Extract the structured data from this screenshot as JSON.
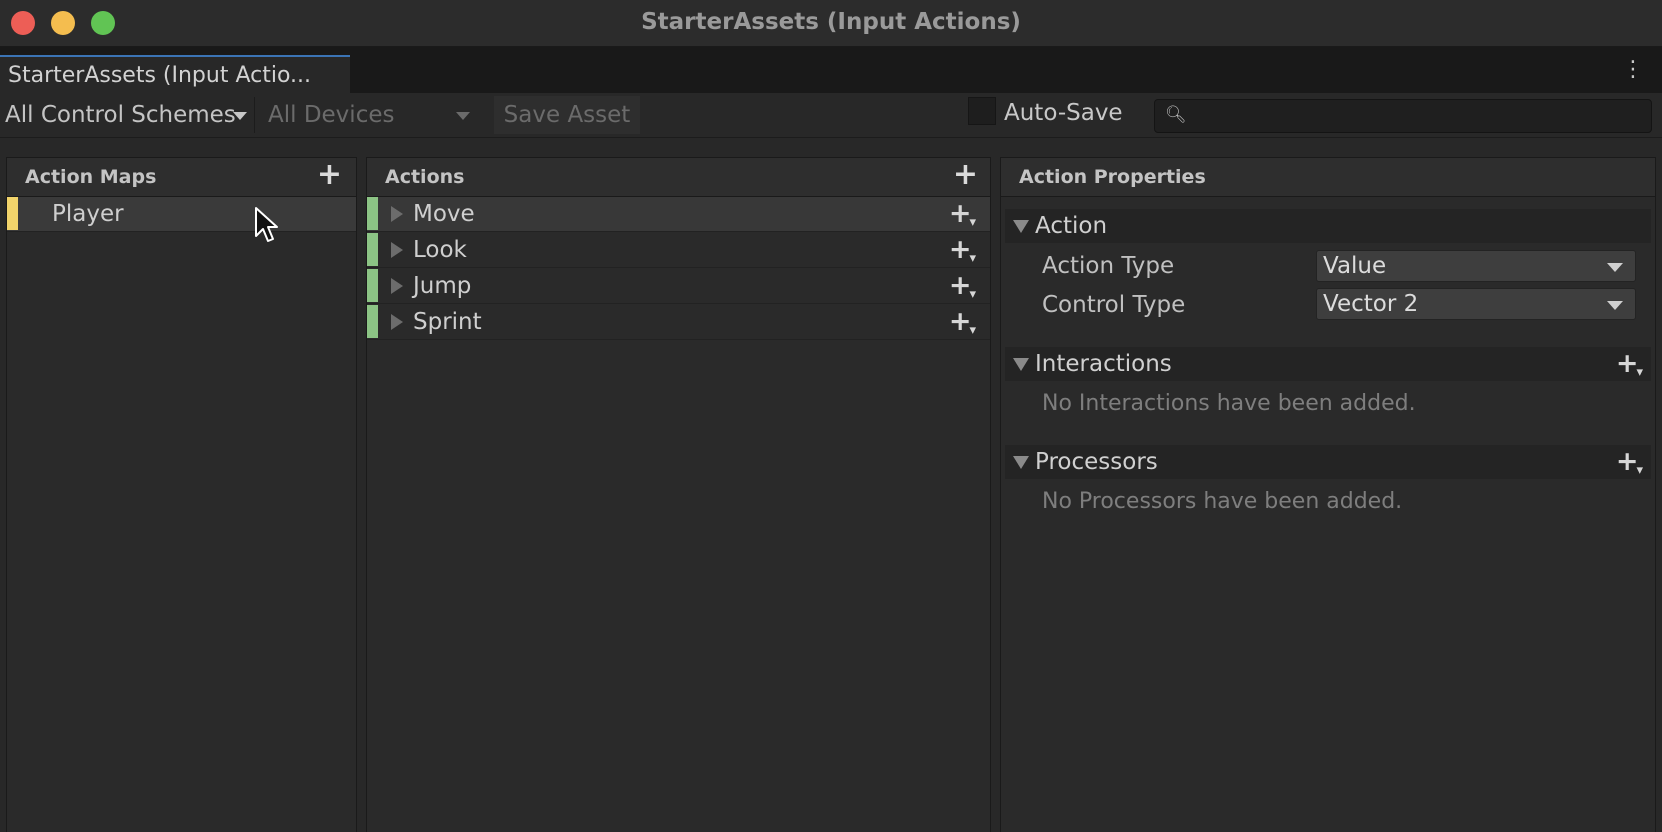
{
  "window": {
    "title": "StarterAssets (Input Actions)"
  },
  "tab": {
    "label": "StarterAssets (Input Actio...",
    "menu_icon": "kebab-menu-icon"
  },
  "toolbar": {
    "control_schemes": "All Control Schemes",
    "devices": "All Devices",
    "save_asset": "Save Asset",
    "auto_save_label": "Auto-Save",
    "auto_save_checked": false,
    "search_placeholder": ""
  },
  "action_maps": {
    "header": "Action Maps",
    "items": [
      {
        "label": "Player",
        "color": "#f2d46b"
      }
    ]
  },
  "actions": {
    "header": "Actions",
    "items": [
      {
        "label": "Move",
        "color": "#8cc485"
      },
      {
        "label": "Look",
        "color": "#8cc485"
      },
      {
        "label": "Jump",
        "color": "#8cc485"
      },
      {
        "label": "Sprint",
        "color": "#8cc485"
      }
    ]
  },
  "properties": {
    "header": "Action Properties",
    "action_section": {
      "title": "Action",
      "action_type_label": "Action Type",
      "action_type_value": "Value",
      "control_type_label": "Control Type",
      "control_type_value": "Vector 2"
    },
    "interactions": {
      "title": "Interactions",
      "empty": "No Interactions have been added."
    },
    "processors": {
      "title": "Processors",
      "empty": "No Processors have been added."
    }
  },
  "colors": {
    "map_accent": "#f2d46b",
    "action_accent": "#8cc485",
    "tab_accent": "#3b74b5"
  }
}
